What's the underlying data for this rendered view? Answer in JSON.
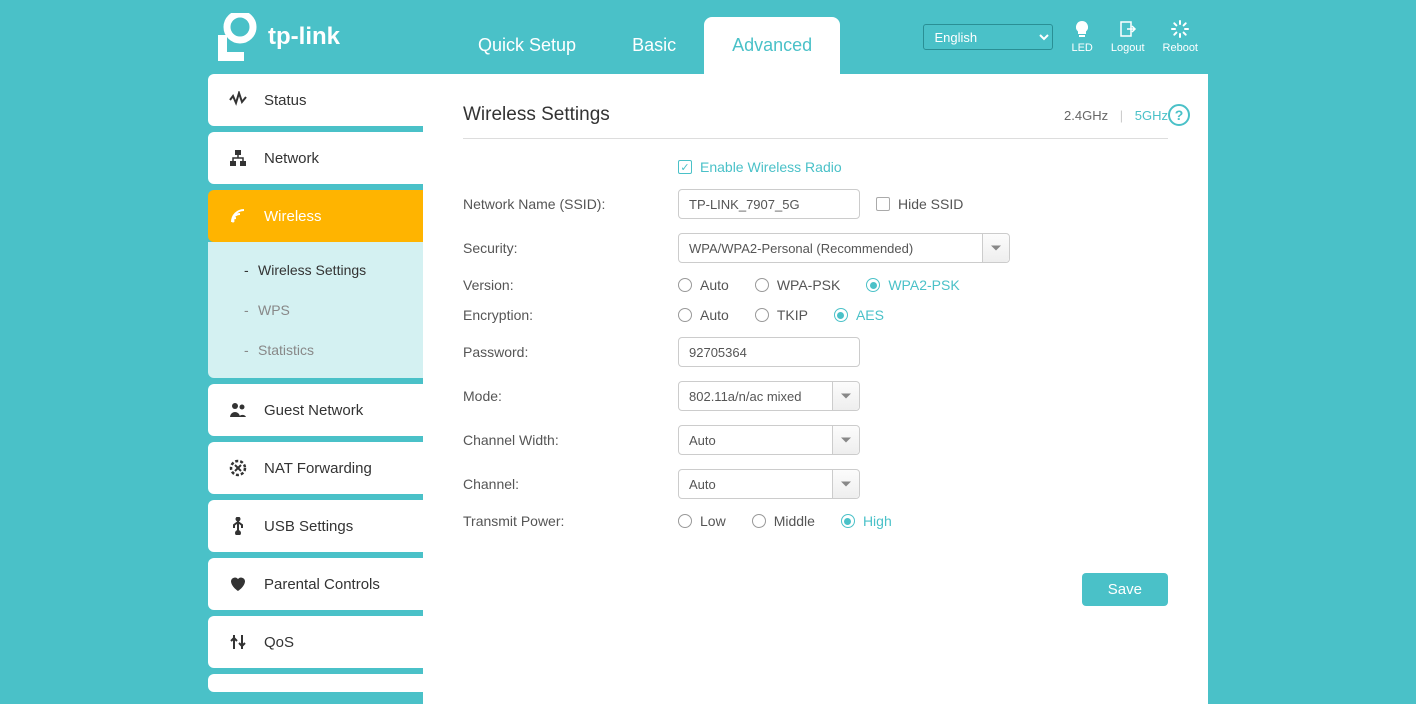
{
  "brand": "tp-link",
  "tabs": {
    "quick_setup": "Quick Setup",
    "basic": "Basic",
    "advanced": "Advanced"
  },
  "header": {
    "language": "English",
    "led": "LED",
    "logout": "Logout",
    "reboot": "Reboot"
  },
  "sidebar": {
    "status": "Status",
    "network": "Network",
    "wireless": "Wireless",
    "wireless_sub": {
      "settings": "Wireless Settings",
      "wps": "WPS",
      "statistics": "Statistics"
    },
    "guest_network": "Guest Network",
    "nat_forwarding": "NAT Forwarding",
    "usb_settings": "USB Settings",
    "parental_controls": "Parental Controls",
    "qos": "QoS"
  },
  "page": {
    "title": "Wireless Settings",
    "band24": "2.4GHz",
    "band5": "5GHz",
    "enable_radio": "Enable Wireless Radio",
    "labels": {
      "ssid": "Network Name (SSID):",
      "hide_ssid": "Hide SSID",
      "security": "Security:",
      "version": "Version:",
      "encryption": "Encryption:",
      "password": "Password:",
      "mode": "Mode:",
      "channel_width": "Channel Width:",
      "channel": "Channel:",
      "transmit_power": "Transmit Power:"
    },
    "values": {
      "ssid": "TP-LINK_7907_5G",
      "security": "WPA/WPA2-Personal (Recommended)",
      "password": "92705364",
      "mode": "802.11a/n/ac mixed",
      "channel_width": "Auto",
      "channel": "Auto"
    },
    "options": {
      "version": {
        "auto": "Auto",
        "wpa_psk": "WPA-PSK",
        "wpa2_psk": "WPA2-PSK"
      },
      "encryption": {
        "auto": "Auto",
        "tkip": "TKIP",
        "aes": "AES"
      },
      "power": {
        "low": "Low",
        "middle": "Middle",
        "high": "High"
      }
    },
    "save": "Save"
  }
}
